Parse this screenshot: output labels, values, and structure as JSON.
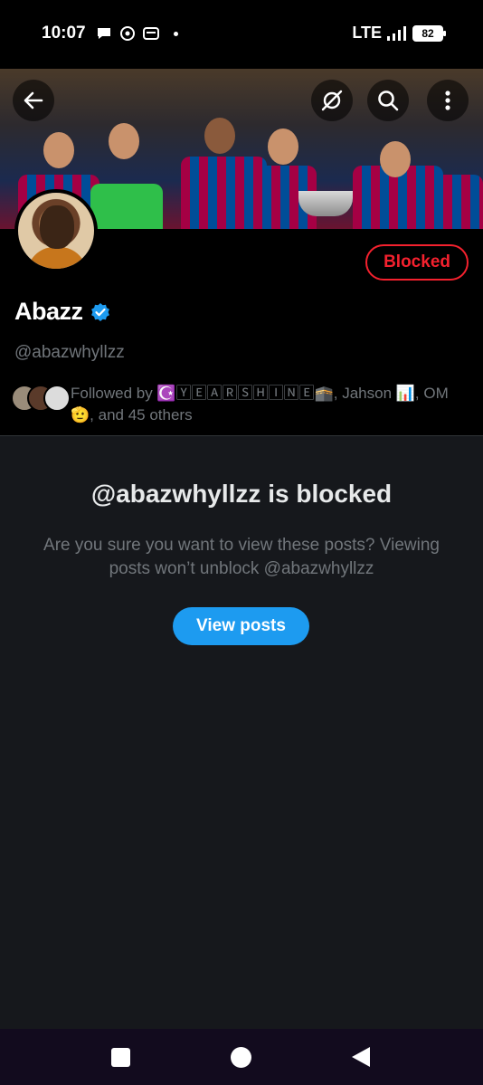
{
  "status_bar": {
    "time": "10:07",
    "network": "LTE",
    "battery": "82"
  },
  "header": {
    "back_icon": "arrow-left-icon",
    "actions": [
      "no-sync-icon",
      "search-icon",
      "more-vertical-icon"
    ]
  },
  "profile": {
    "display_name": "Abazz",
    "handle": "@abazwhyllzz",
    "verified": true,
    "blocked_button_label": "Blocked",
    "followed_by_text": "Followed by ☪️🅈🄴🄰🅁🅂🄷🄸🄽🄴🕋, Jahson 📊, OM🫡, and 45 others"
  },
  "blocked_notice": {
    "title": "@abazwhyllzz is blocked",
    "description": "Are you sure you want to view these posts? Viewing posts won’t unblock @abazwhyllzz",
    "view_posts_label": "View posts"
  },
  "colors": {
    "accent": "#1d9bf0",
    "blocked_red": "#f4212e",
    "muted_text": "#71767b",
    "background": "#16181c"
  },
  "nav_bar": {
    "buttons": [
      "recents-square-icon",
      "home-circle-icon",
      "back-triangle-icon"
    ]
  }
}
